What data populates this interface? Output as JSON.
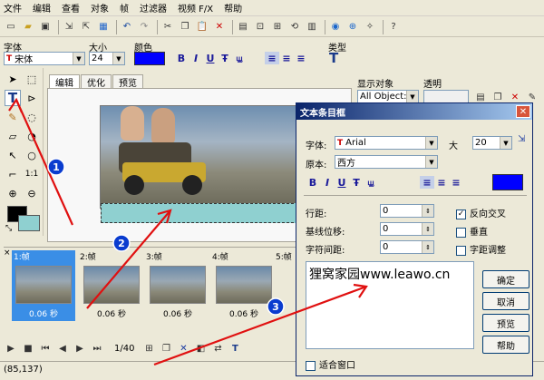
{
  "menu": [
    "文件",
    "编辑",
    "查看",
    "对象",
    "帧",
    "过滤器",
    "视频 F/X",
    "帮助"
  ],
  "font_panel": {
    "font_label": "字体",
    "font_value": "宋体",
    "size_label": "大小",
    "size_value": "24",
    "color_label": "颜色",
    "type_label": "类型"
  },
  "tabs": [
    "编辑",
    "优化",
    "预览"
  ],
  "right_panel": {
    "show_label": "显示对象",
    "show_value": "All Object:",
    "opacity_label": "透明"
  },
  "frames": [
    {
      "name": "1:帧",
      "time": "0.06 秒"
    },
    {
      "name": "2:帧",
      "time": "0.06 秒"
    },
    {
      "name": "3:帧",
      "time": "0.06 秒"
    },
    {
      "name": "4:帧",
      "time": "0.06 秒"
    },
    {
      "name": "5:帧",
      "time": ""
    }
  ],
  "frame_counter": "1/40",
  "status": "(85,137)",
  "dialog": {
    "title": "文本条目框",
    "font_label": "字体:",
    "font_value": "Arial",
    "size_label": "大",
    "size_value": "20",
    "origin_label": "原本:",
    "origin_value": "西方",
    "line_spacing_label": "行距:",
    "line_spacing_value": "0",
    "baseline_label": "基线位移:",
    "baseline_value": "0",
    "char_spacing_label": "字符间距:",
    "char_spacing_value": "0",
    "aa_label": "反向交叉",
    "vertical_label": "垂直",
    "kerning_label": "字距调整",
    "text": "狸窝家园www.leawo.cn",
    "ok": "确定",
    "cancel": "取消",
    "preview": "预览",
    "help": "帮助",
    "fit_label": "适合窗口"
  },
  "callouts": [
    "1",
    "2",
    "3"
  ],
  "colors": {
    "accent": "#0000ff",
    "arrow": "#e01010",
    "badge": "#0a3ccf",
    "bg_color": "#8fd0d0"
  }
}
